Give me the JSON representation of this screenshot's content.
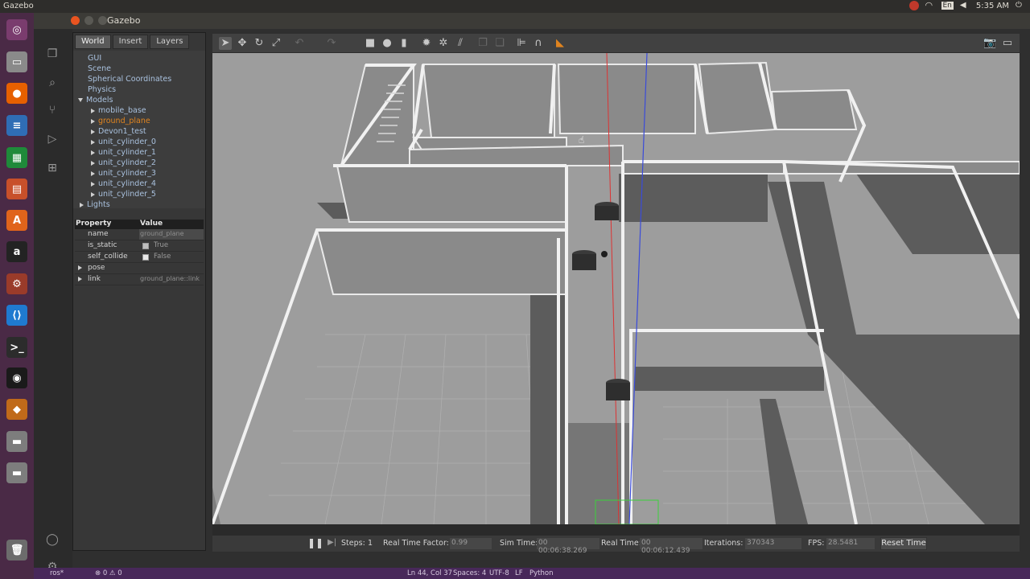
{
  "system": {
    "app_name": "Gazebo",
    "time": "5:35 AM",
    "tray_icons": [
      "ros-icon",
      "wifi-icon",
      "keyboard-en-icon",
      "volume-icon",
      "power-icon"
    ],
    "keyboard_label": "En"
  },
  "launcher": {
    "items": [
      {
        "name": "ubuntu-dash-icon",
        "color": "#7a3c6e",
        "glyph": "◎"
      },
      {
        "name": "files-icon",
        "color": "#8a8a8a",
        "glyph": "▭"
      },
      {
        "name": "firefox-icon",
        "color": "#e66000",
        "glyph": "●"
      },
      {
        "name": "libreoffice-writer-icon",
        "color": "#2f6db5",
        "glyph": "≡"
      },
      {
        "name": "libreoffice-calc-icon",
        "color": "#1f8a3a",
        "glyph": "▦"
      },
      {
        "name": "libreoffice-impress-icon",
        "color": "#c8502a",
        "glyph": "▤"
      },
      {
        "name": "software-center-icon",
        "color": "#e0641b",
        "glyph": "A"
      },
      {
        "name": "amazon-icon",
        "color": "#232323",
        "glyph": "a"
      },
      {
        "name": "settings-icon",
        "color": "#9a3b2a",
        "glyph": "⚙"
      },
      {
        "name": "vscode-icon",
        "color": "#1f7ad0",
        "glyph": "⟨⟩"
      },
      {
        "name": "terminal-icon",
        "color": "#2c2c2c",
        "glyph": ">_"
      },
      {
        "name": "obs-icon",
        "color": "#1a1a1a",
        "glyph": "◉"
      },
      {
        "name": "virtualbox-icon",
        "color": "#c06a1a",
        "glyph": "◆"
      },
      {
        "name": "drive-icon",
        "color": "#7d7d7d",
        "glyph": "▬"
      },
      {
        "name": "drive-icon-2",
        "color": "#7d7d7d",
        "glyph": "▬"
      },
      {
        "name": "trash-icon",
        "color": "#6c6c6c",
        "glyph": "🗑"
      }
    ]
  },
  "window": {
    "title": "Gazebo"
  },
  "panel": {
    "tabs": [
      "World",
      "Insert",
      "Layers"
    ],
    "tree": {
      "gui": "GUI",
      "scene": "Scene",
      "spherical": "Spherical Coordinates",
      "physics": "Physics",
      "models": "Models",
      "model_items": [
        "mobile_base",
        "ground_plane",
        "Devon1_test",
        "unit_cylinder_0",
        "unit_cylinder_1",
        "unit_cylinder_2",
        "unit_cylinder_3",
        "unit_cylinder_4",
        "unit_cylinder_5"
      ],
      "lights": "Lights"
    },
    "properties": {
      "header_property": "Property",
      "header_value": "Value",
      "rows": [
        {
          "key": "name",
          "value": "ground_plane"
        },
        {
          "key": "is_static",
          "value": "True"
        },
        {
          "key": "self_collide",
          "value": "False"
        },
        {
          "key": "pose",
          "value": ""
        },
        {
          "key": "link",
          "value": "ground_plane::link"
        }
      ]
    }
  },
  "status": {
    "steps_label": "Steps:",
    "steps_value": "1",
    "rtf_label": "Real Time Factor:",
    "rtf_value": "0.99",
    "sim_label": "Sim Time:",
    "sim_value": "00 00:06:38.269",
    "real_label": "Real Time:",
    "real_value": "00 00:06:12.439",
    "iter_label": "Iterations:",
    "iter_value": "370343",
    "fps_label": "FPS:",
    "fps_value": "28.5481",
    "reset_label": "Reset Time"
  },
  "vscode_bar": {
    "remote": "ros*",
    "problems": "⊗ 0 ⚠ 0",
    "position": "Ln 44, Col 37",
    "spaces": "Spaces: 4",
    "encoding": "UTF-8",
    "eol": "LF",
    "language": "Python"
  }
}
